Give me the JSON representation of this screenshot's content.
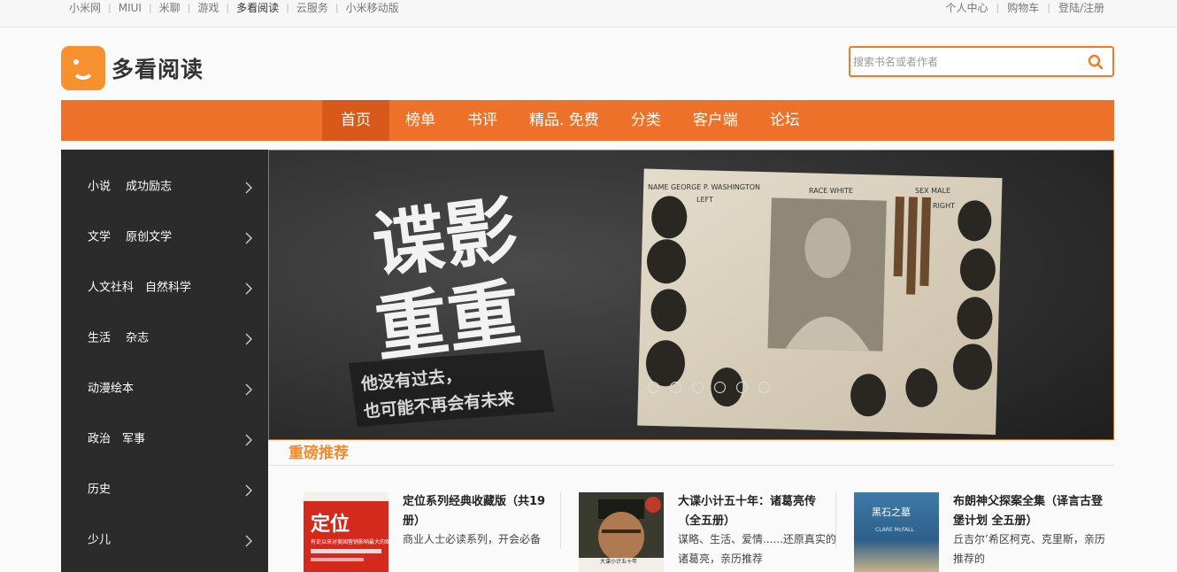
{
  "topnav": [
    "小米网",
    "MIUI",
    "米聊",
    "游戏",
    "多看阅读",
    "云服务",
    "小米移动版"
  ],
  "userlinks": [
    "个人中心",
    "购物车",
    "登陆/注册"
  ],
  "logo": {
    "text": "多看阅读"
  },
  "search": {
    "placeholder": "搜索书名或者作者",
    "icon": "search-icon"
  },
  "mainnav": {
    "active": "首页",
    "items": [
      "首页",
      "榜单",
      "书评",
      "精品. 免费",
      "分类",
      "客户端",
      "论坛"
    ]
  },
  "sidebar": [
    "小说　 成功励志",
    "文学　 原创文学",
    "人文社科　自然科学",
    "生活　 杂志",
    "动漫绘本",
    "政治　军事",
    "历史",
    "少儿"
  ],
  "banner": {
    "title_line1": "谍影",
    "title_line2": "重重",
    "tagline_line1": "他没有过去，",
    "tagline_line2": "也可能不再会有未来",
    "card_name": "NAME GEORGE P. WASHINGTON",
    "card_race": "RACE WHITE",
    "card_sex": "SEX MALE",
    "card_left": "LEFT",
    "card_right": "RIGHT",
    "slide_count": 6,
    "active_slide": 1
  },
  "recommend": {
    "title": "重磅推荐",
    "books": [
      {
        "title": "定位系列经典收藏版（共19册）",
        "desc": "商业人士必读系列，开会必备",
        "cover_text": "定位",
        "cover_sub": "有史以来对美国营销影响最大的观念",
        "cover_color": "#d42a1e"
      },
      {
        "title": "大谍小计五十年：诸葛亮传（全五册）",
        "desc": "谋略、生活、爱情......还原真实的诸葛亮，亲历推荐",
        "cover_text": "大谍小计五十年",
        "cover_color": "#3a3a2e"
      },
      {
        "title": "布朗神父探案全集（译言古登堡计划 全五册）",
        "desc": "丘吉尔’希区柯克、克里斯，亲历推荐的",
        "cover_text": "黑石之墓",
        "cover_sub": "CLARE McFALL",
        "cover_color": "#2d5f8a"
      }
    ]
  },
  "colors": {
    "brand_orange": "#ed7128",
    "active_nav": "#d9591b",
    "sidebar_bg": "#2b2b2b",
    "accent_title": "#f08a2c"
  }
}
